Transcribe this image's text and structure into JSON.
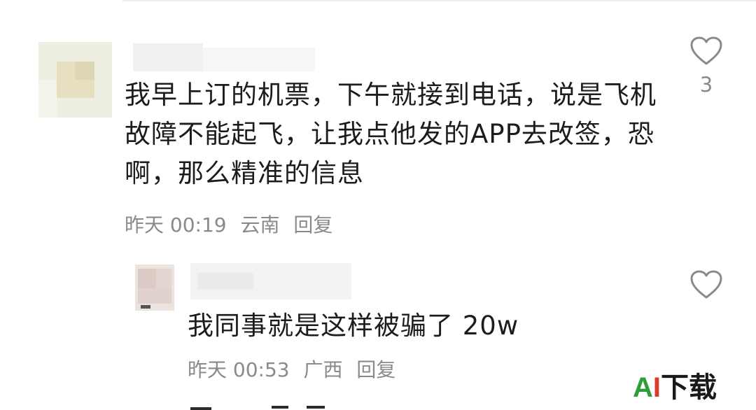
{
  "comments": [
    {
      "text": "我早上订的机票，下午就接到电话，说是飞机故障不能起飞，让我点他发的APP去改签，恐啊，那么精准的信息",
      "time": "昨天 00:19",
      "location": "云南",
      "reply_label": "回复",
      "likes": "3"
    },
    {
      "text": "我同事就是这样被骗了 20w",
      "time": "昨天 00:53",
      "location": "广西",
      "reply_label": "回复",
      "likes": ""
    }
  ],
  "watermark": {
    "part1": "A",
    "part2": "I",
    "part3": "下载"
  },
  "colors": {
    "meta_text": "#8a8a8a",
    "heart_stroke": "#8a8a8a",
    "watermark_green": "#2f9e3a",
    "watermark_red": "#d93a2b"
  }
}
